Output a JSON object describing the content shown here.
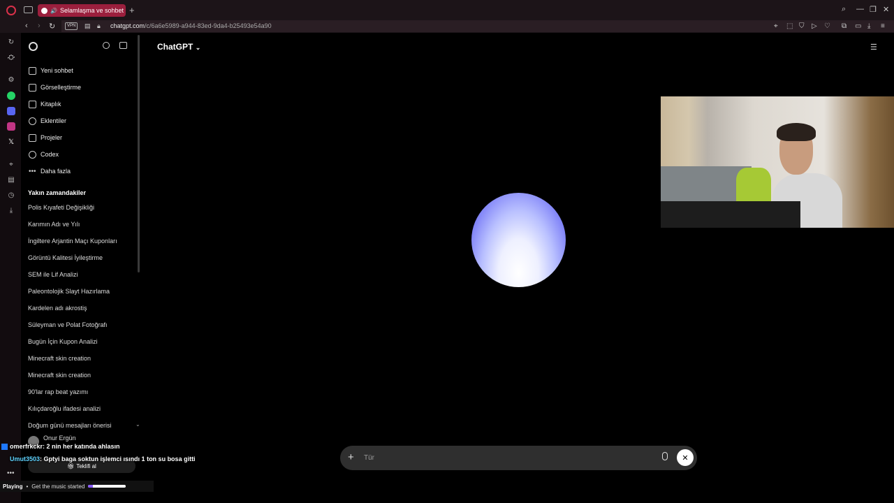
{
  "browser": {
    "tab_title": "Selamlaşma ve sohbet",
    "vpn_label": "VPN",
    "url_host": "chatgpt.com",
    "url_path": "/c/6a6e5989-a944-83ed-9da4-b25493e54a90"
  },
  "sidebar": {
    "nav": [
      {
        "label": "Yeni sohbet",
        "icon": "edit-icon"
      },
      {
        "label": "Görselleştirme",
        "icon": "images-icon"
      },
      {
        "label": "Kitaplık",
        "icon": "library-icon"
      },
      {
        "label": "Eklentiler",
        "icon": "at-icon"
      },
      {
        "label": "Projeler",
        "icon": "folder-icon"
      },
      {
        "label": "Codex",
        "icon": "codex-icon"
      },
      {
        "label": "Daha fazla",
        "icon": "more-icon"
      }
    ],
    "section_title": "Yakın zamandakiler",
    "history": [
      "Polis Kıyafeti Değişikliği",
      "Karımın Adı ve Yılı",
      "İngiltere Arjantin Maçı Kuponları",
      "Görüntü Kalitesi İyileştirme",
      "SEM ile Lif Analizi",
      "Paleontolojik Slayt Hazırlama",
      "Kardelen adı akrostiş",
      "Süleyman ve Polat Fotoğrafı",
      "Bugün İçin Kupon Analizi",
      "Minecraft skin creation",
      "Minecraft skin creation",
      "90'lar rap beat yazımı",
      "Kılıçdaroğlu ifadesi analizi",
      "Doğum günü mesajları önerisi"
    ],
    "user_name": "Onur Ergün",
    "upgrade_label": "Teklifi al"
  },
  "main": {
    "title": "ChatGPT",
    "composer_placeholder": "Tür"
  },
  "overlay": {
    "chat": [
      {
        "user": "omerfrkckr",
        "message": ": 2 nin her katında ahlasın"
      },
      {
        "user": "Umut3503",
        "message": ": Gptyi baga soktun işlemci ısındı 1 ton su bosa gitti"
      }
    ],
    "music_status": "Playing",
    "music_text": "Get the music started",
    "music_progress": 0.12
  },
  "colors": {
    "tab_accent": "#9b1f3d",
    "orb_top": "#6a6cf0",
    "orb_bottom": "#ffffff",
    "chat_user2": "#5fd3ff"
  }
}
